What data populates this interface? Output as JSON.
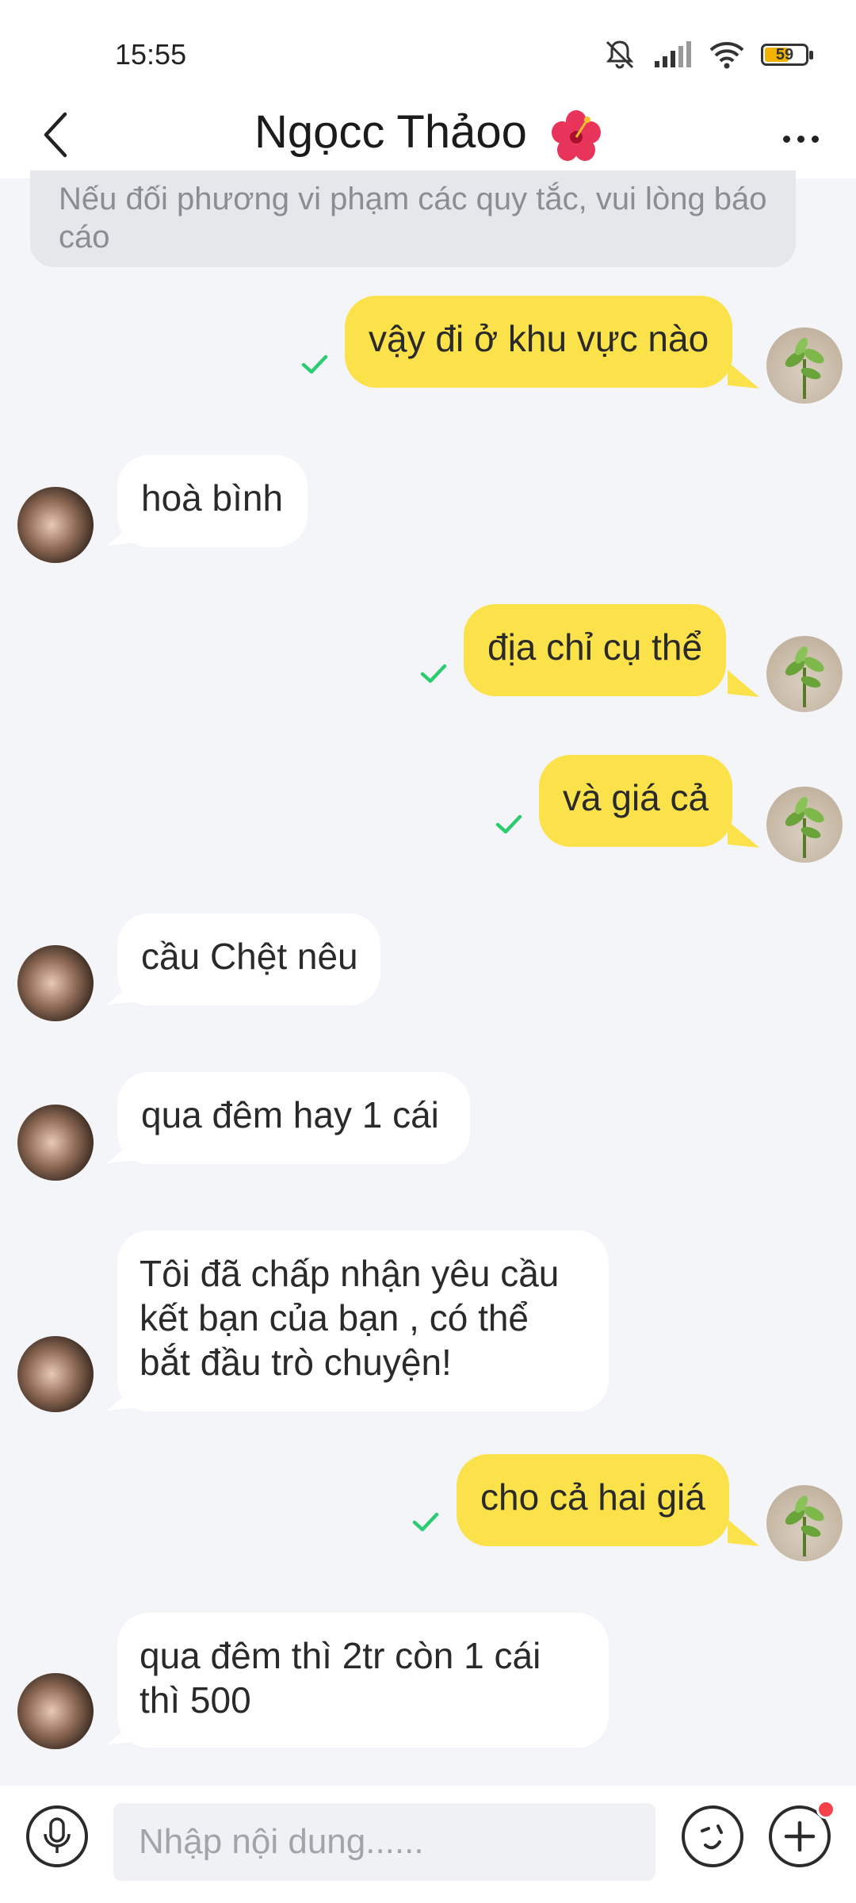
{
  "status": {
    "time": "15:55",
    "battery": "59",
    "battery_level": 0.59
  },
  "header": {
    "title": "Ngọcc Thảoo",
    "title_emoji": "hibiscus-icon"
  },
  "notice": "Nếu đối phương vi phạm các quy tắc, vui lòng báo cáo",
  "messages": [
    {
      "from": "me",
      "text": "vậy đi ở khu vực nào"
    },
    {
      "from": "them",
      "text": "hoà bình"
    },
    {
      "from": "me",
      "text": "địa chỉ cụ thể"
    },
    {
      "from": "me",
      "text": "và giá cả"
    },
    {
      "from": "them",
      "text": "cầu Chệt nêu"
    },
    {
      "from": "them",
      "text": "qua đêm hay 1 cái"
    },
    {
      "from": "them",
      "text": "Tôi đã chấp nhận yêu cầu kết bạn của bạn , có thể bắt đầu trò chuyện!"
    },
    {
      "from": "me",
      "text": "cho cả hai giá"
    },
    {
      "from": "them",
      "text": "qua đêm thì 2tr còn 1 cái thì 500"
    }
  ],
  "input": {
    "placeholder": "Nhập nội dung......"
  },
  "colors": {
    "my_bubble": "#fbe14a",
    "their_bubble": "#ffffff",
    "check": "#2ecc71",
    "background": "#f4f5f9",
    "notification_dot": "#f5414a"
  }
}
